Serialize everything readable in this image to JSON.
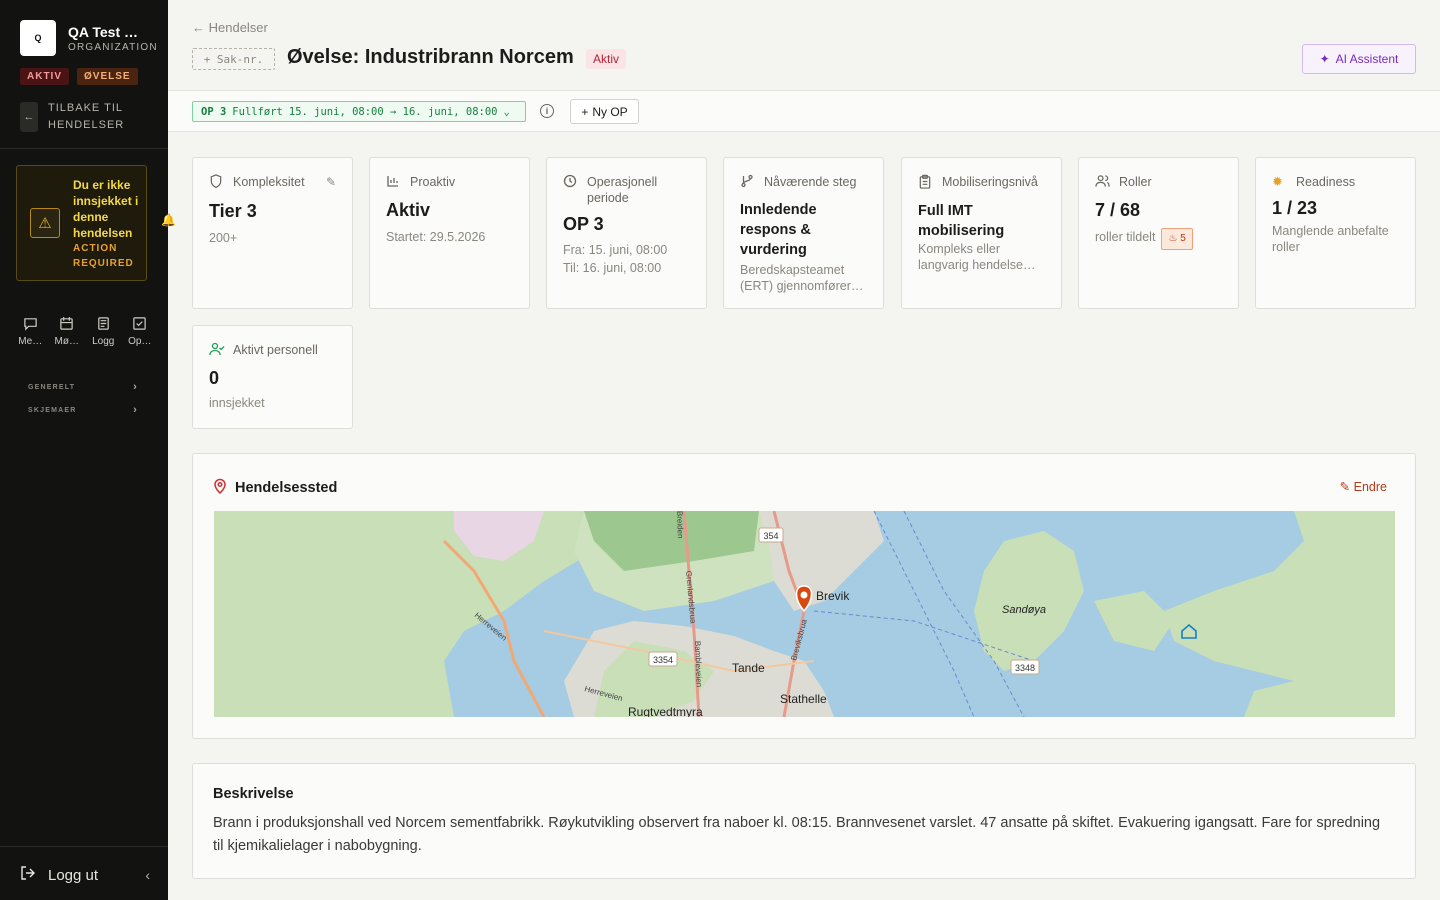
{
  "sidebar": {
    "org_logo": "Q",
    "org_name": "QA Test …",
    "org_type": "ORGANIZATION",
    "badges": [
      "AKTIV",
      "ØVELSE"
    ],
    "back_label": "TILBAKE TIL HENDELSER",
    "warning": {
      "text": "Du er ikke innsjekket i denne hendelsen",
      "action": "ACTION REQUIRED"
    },
    "nav": [
      {
        "label": "Me…",
        "icon": "message-icon"
      },
      {
        "label": "Mø…",
        "icon": "calendar-icon"
      },
      {
        "label": "Logg",
        "icon": "log-icon"
      },
      {
        "label": "Op…",
        "icon": "task-check-icon"
      }
    ],
    "sections": [
      "GENERELT",
      "SKJEMAER"
    ],
    "logout": "Logg ut"
  },
  "header": {
    "breadcrumb": "← Hendelser",
    "case_number_placeholder": "+ Sak-nr.",
    "title": "Øvelse: Industribrann Norcem",
    "status": "Aktiv",
    "ai_button": "AI Assistent"
  },
  "op_bar": {
    "op": "OP 3",
    "state": "Fullført",
    "range": "15. juni, 08:00 → 16. juni, 08:00",
    "new_op": "Ny OP"
  },
  "cards": {
    "complexity": {
      "label": "Kompleksitet",
      "value": "Tier 3",
      "sub": "200+"
    },
    "proactive": {
      "label": "Proaktiv",
      "value": "Aktiv",
      "sub": "Startet: 29.5.2026"
    },
    "op_period": {
      "label": "Operasjonell periode",
      "value": "OP 3",
      "from": "Fra: 15. juni, 08:00",
      "to": "Til: 16. juni, 08:00"
    },
    "current_step": {
      "label": "Nåværende steg",
      "value": "Innledende respons & vurdering",
      "sub": "Beredskapsteamet (ERT) gjennomfører…"
    },
    "mobilization": {
      "label": "Mobiliseringsnivå",
      "value": "Full IMT mobilisering",
      "sub": "Kompleks eller langvarig hendelse…"
    },
    "roles": {
      "label": "Roller",
      "value": "7 / 68",
      "sub": "roller tildelt",
      "alert": "5"
    },
    "readiness": {
      "label": "Readiness",
      "value": "1 / 23",
      "sub": "Manglende anbefalte roller"
    },
    "personnel": {
      "label": "Aktivt personell",
      "value": "0",
      "sub": "innsjekket"
    }
  },
  "location": {
    "title": "Hendelsessted",
    "edit": "Endre",
    "map_labels": {
      "town1": "Brevik",
      "town2": "Sandøya",
      "town3": "Tande",
      "town4": "Stathelle",
      "town5": "Rugtvedtmyra",
      "road1": "354",
      "road2": "3354",
      "road3": "3348",
      "street1": "Herreveien",
      "street2": "Grenlandsbrua",
      "street3": "Bambleveien",
      "street4": "Breviksbrua",
      "street5": "Herreveien",
      "street6": "Breiden"
    }
  },
  "description": {
    "title": "Beskrivelse",
    "text": "Brann i produksjonshall ved Norcem sementfabrikk. Røykutvikling observert fra naboer kl. 08:15. Brannvesenet varslet. 47 ansatte på skiftet. Evakuering igangsatt. Fare for spredning til kjemikalielager i nabobygning."
  }
}
